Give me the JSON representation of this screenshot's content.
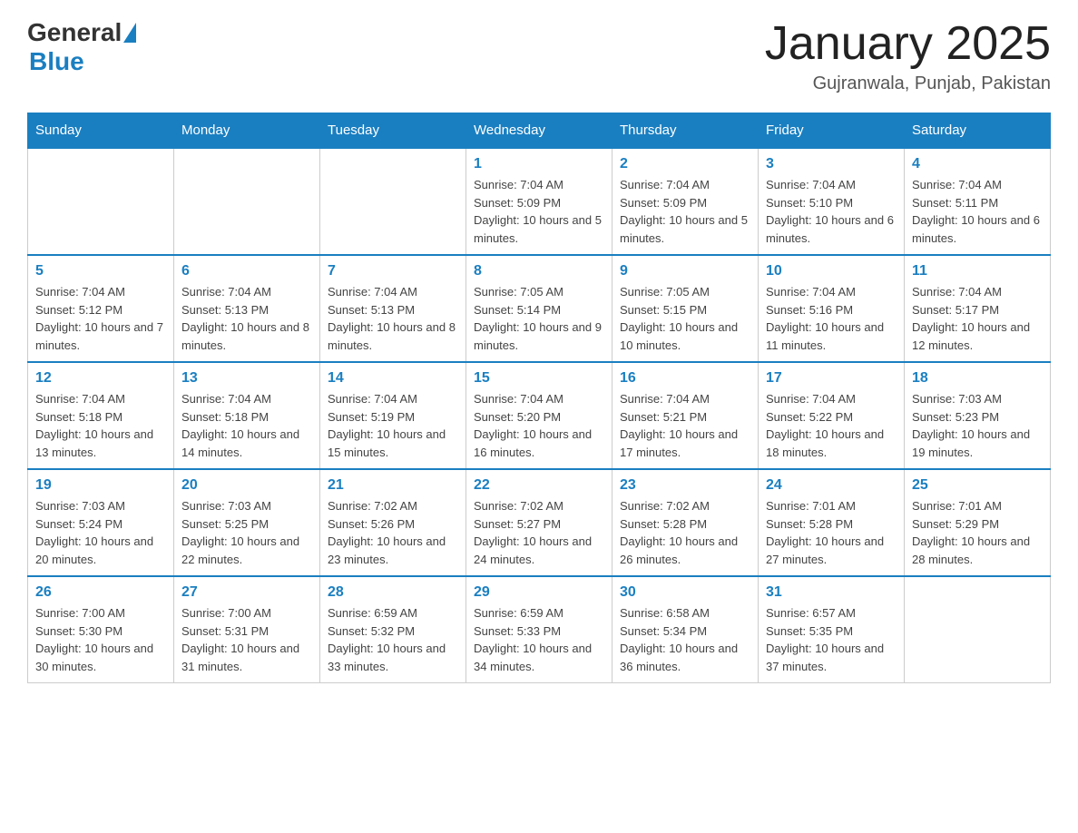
{
  "header": {
    "logo": {
      "general": "General",
      "blue": "Blue"
    },
    "title": "January 2025",
    "subtitle": "Gujranwala, Punjab, Pakistan"
  },
  "days_of_week": [
    "Sunday",
    "Monday",
    "Tuesday",
    "Wednesday",
    "Thursday",
    "Friday",
    "Saturday"
  ],
  "weeks": [
    [
      {
        "day": "",
        "info": ""
      },
      {
        "day": "",
        "info": ""
      },
      {
        "day": "",
        "info": ""
      },
      {
        "day": "1",
        "info": "Sunrise: 7:04 AM\nSunset: 5:09 PM\nDaylight: 10 hours and 5 minutes."
      },
      {
        "day": "2",
        "info": "Sunrise: 7:04 AM\nSunset: 5:09 PM\nDaylight: 10 hours and 5 minutes."
      },
      {
        "day": "3",
        "info": "Sunrise: 7:04 AM\nSunset: 5:10 PM\nDaylight: 10 hours and 6 minutes."
      },
      {
        "day": "4",
        "info": "Sunrise: 7:04 AM\nSunset: 5:11 PM\nDaylight: 10 hours and 6 minutes."
      }
    ],
    [
      {
        "day": "5",
        "info": "Sunrise: 7:04 AM\nSunset: 5:12 PM\nDaylight: 10 hours and 7 minutes."
      },
      {
        "day": "6",
        "info": "Sunrise: 7:04 AM\nSunset: 5:13 PM\nDaylight: 10 hours and 8 minutes."
      },
      {
        "day": "7",
        "info": "Sunrise: 7:04 AM\nSunset: 5:13 PM\nDaylight: 10 hours and 8 minutes."
      },
      {
        "day": "8",
        "info": "Sunrise: 7:05 AM\nSunset: 5:14 PM\nDaylight: 10 hours and 9 minutes."
      },
      {
        "day": "9",
        "info": "Sunrise: 7:05 AM\nSunset: 5:15 PM\nDaylight: 10 hours and 10 minutes."
      },
      {
        "day": "10",
        "info": "Sunrise: 7:04 AM\nSunset: 5:16 PM\nDaylight: 10 hours and 11 minutes."
      },
      {
        "day": "11",
        "info": "Sunrise: 7:04 AM\nSunset: 5:17 PM\nDaylight: 10 hours and 12 minutes."
      }
    ],
    [
      {
        "day": "12",
        "info": "Sunrise: 7:04 AM\nSunset: 5:18 PM\nDaylight: 10 hours and 13 minutes."
      },
      {
        "day": "13",
        "info": "Sunrise: 7:04 AM\nSunset: 5:18 PM\nDaylight: 10 hours and 14 minutes."
      },
      {
        "day": "14",
        "info": "Sunrise: 7:04 AM\nSunset: 5:19 PM\nDaylight: 10 hours and 15 minutes."
      },
      {
        "day": "15",
        "info": "Sunrise: 7:04 AM\nSunset: 5:20 PM\nDaylight: 10 hours and 16 minutes."
      },
      {
        "day": "16",
        "info": "Sunrise: 7:04 AM\nSunset: 5:21 PM\nDaylight: 10 hours and 17 minutes."
      },
      {
        "day": "17",
        "info": "Sunrise: 7:04 AM\nSunset: 5:22 PM\nDaylight: 10 hours and 18 minutes."
      },
      {
        "day": "18",
        "info": "Sunrise: 7:03 AM\nSunset: 5:23 PM\nDaylight: 10 hours and 19 minutes."
      }
    ],
    [
      {
        "day": "19",
        "info": "Sunrise: 7:03 AM\nSunset: 5:24 PM\nDaylight: 10 hours and 20 minutes."
      },
      {
        "day": "20",
        "info": "Sunrise: 7:03 AM\nSunset: 5:25 PM\nDaylight: 10 hours and 22 minutes."
      },
      {
        "day": "21",
        "info": "Sunrise: 7:02 AM\nSunset: 5:26 PM\nDaylight: 10 hours and 23 minutes."
      },
      {
        "day": "22",
        "info": "Sunrise: 7:02 AM\nSunset: 5:27 PM\nDaylight: 10 hours and 24 minutes."
      },
      {
        "day": "23",
        "info": "Sunrise: 7:02 AM\nSunset: 5:28 PM\nDaylight: 10 hours and 26 minutes."
      },
      {
        "day": "24",
        "info": "Sunrise: 7:01 AM\nSunset: 5:28 PM\nDaylight: 10 hours and 27 minutes."
      },
      {
        "day": "25",
        "info": "Sunrise: 7:01 AM\nSunset: 5:29 PM\nDaylight: 10 hours and 28 minutes."
      }
    ],
    [
      {
        "day": "26",
        "info": "Sunrise: 7:00 AM\nSunset: 5:30 PM\nDaylight: 10 hours and 30 minutes."
      },
      {
        "day": "27",
        "info": "Sunrise: 7:00 AM\nSunset: 5:31 PM\nDaylight: 10 hours and 31 minutes."
      },
      {
        "day": "28",
        "info": "Sunrise: 6:59 AM\nSunset: 5:32 PM\nDaylight: 10 hours and 33 minutes."
      },
      {
        "day": "29",
        "info": "Sunrise: 6:59 AM\nSunset: 5:33 PM\nDaylight: 10 hours and 34 minutes."
      },
      {
        "day": "30",
        "info": "Sunrise: 6:58 AM\nSunset: 5:34 PM\nDaylight: 10 hours and 36 minutes."
      },
      {
        "day": "31",
        "info": "Sunrise: 6:57 AM\nSunset: 5:35 PM\nDaylight: 10 hours and 37 minutes."
      },
      {
        "day": "",
        "info": ""
      }
    ]
  ]
}
